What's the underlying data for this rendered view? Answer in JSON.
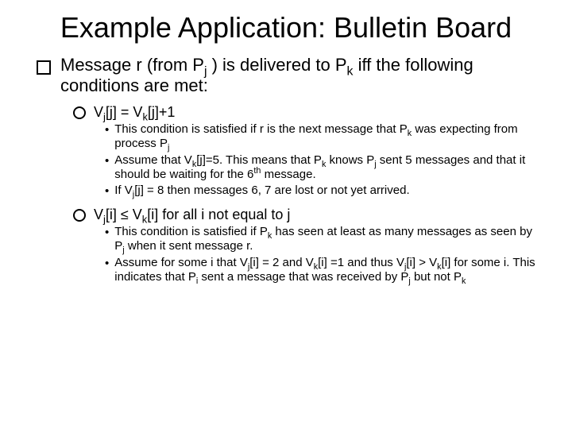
{
  "title": "Example Application: Bulletin Board",
  "main": {
    "text_a": "Message r (from P",
    "sub_a": "j",
    "text_b": " ) is delivered to P",
    "sub_b": "k",
    "text_c": " iff the following conditions are met:"
  },
  "cond1": {
    "a": "V",
    "s1": "j",
    "b": "[j] = V",
    "s2": "k",
    "c": "[j]+1"
  },
  "cond1_sub": [
    {
      "a": "This condition is satisfied if r is the next message that P",
      "s1": "k",
      "b": " was expecting from process P",
      "s2": "j",
      "c": ""
    },
    {
      "a": "Assume that V",
      "s1": "k",
      "b": "[j]=5.  This means that P",
      "s2": "k",
      "c": " knows P",
      "s3": "j",
      "d": " sent 5 messages and that it should be waiting for the 6",
      "sup": "th",
      "e": " message."
    },
    {
      "a": "If V",
      "s1": "j",
      "b": "[j] = 8 then messages 6, 7 are lost or not yet arrived."
    }
  ],
  "cond2": {
    "a": "V",
    "s1": "j",
    "b": "[i] ≤ V",
    "s2": "k",
    "c": "[i] for all i not equal to j"
  },
  "cond2_sub": [
    {
      "a": "This condition is satisfied if  P",
      "s1": "k",
      "b": " has seen at least as many messages as seen by P",
      "s2": "j",
      "c": " when it sent message r."
    },
    {
      "a": "Assume for some i that V",
      "s1": "j",
      "b": "[i]  = 2 and V",
      "s2": "k",
      "c": "[i] =1 and thus V",
      "s3": "j",
      "d": "[i] > V",
      "s4": "k",
      "e": "[i] for some i.  This indicates that P",
      "s5": "i",
      "f": " sent a message that was received by P",
      "s6": "j",
      "g": " but not P",
      "s7": "k",
      "h": ""
    }
  ]
}
